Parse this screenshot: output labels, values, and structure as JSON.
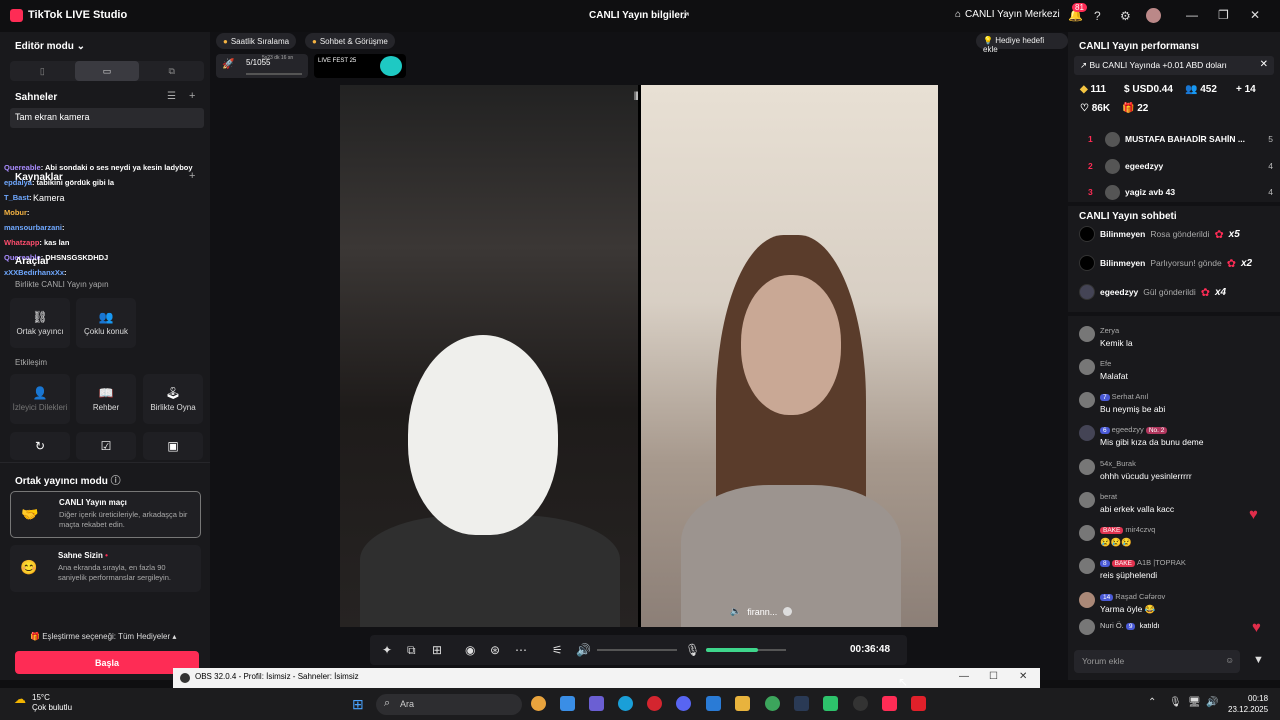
{
  "titlebar": {
    "app_title": "TikTok LIVE Studio",
    "center_title": "CANLI Yayın bilgileri",
    "center_link": "CANLI Yayın Merkezi",
    "notif_count": "81"
  },
  "left": {
    "editor_mode": "Editör modu",
    "scenes_label": "Sahneler",
    "scene_item": "Tam ekran kamera",
    "sources_label": "Kaynaklar",
    "camera_label": "Kamera",
    "tools_label": "Araçlar",
    "together_label": "Birlikte CANLI Yayın yapın",
    "tool_cohost": "Ortak yayıncı",
    "tool_multiguest": "Çoklu konuk",
    "interaction_label": "Etkileşim",
    "tool_viewer": "İzleyici Dilekleri",
    "tool_guide": "Rehber",
    "tool_playtogether": "Birlikte Oyna",
    "cohost_mode": "Ortak yayıncı modu",
    "card1_title": "CANLI Yayın maçı",
    "card1_desc": "Diğer içerik üreticileriyle, arkadaşça bir maçta rekabet edin.",
    "card2_title": "Sahne Sizin",
    "card2_desc": "Ana ekranda sırayla, en fazla 90 saniyelik performanslar sergileyin.",
    "match_option": "Eşleştirme seçeneği: Tüm Hediyeler",
    "start_button": "Başla"
  },
  "chat_overlay": [
    {
      "user": "Quereable",
      "text": ": Abi sondaki o ses neydi ya kesin ladyboy",
      "color": "#a98cff"
    },
    {
      "user": "epdalya",
      "text": ": tabikini gördük gibi la",
      "color": "#6fa8ff"
    },
    {
      "user": "T_Bast",
      "text": ":",
      "color": "#6fa8ff"
    },
    {
      "user": "Mobur",
      "text": ":",
      "color": "#f5b342"
    },
    {
      "user": "mansourbarzani",
      "text": ":",
      "color": "#6fa8ff"
    },
    {
      "user": "Whatzapp",
      "text": ": kas lan",
      "color": "#ff4d6d"
    },
    {
      "user": "Quereable",
      "text": ": DHSNSGSKDHDJ",
      "color": "#a98cff"
    },
    {
      "user": "xXXBedirhanxXx",
      "text": ":",
      "color": "#6fa8ff"
    }
  ],
  "center": {
    "pill1": "Saatlik Sıralama",
    "pill2": "Sohbet & Görüşme",
    "goal": "Hediye hedefi ekle",
    "progress": "5/1055",
    "progress_time": "5s23 dk 16 sn",
    "fest": "LIVE FEST 25",
    "guest_name": "firann...",
    "timer": "00:36:48",
    "mic_level": 0.65
  },
  "right": {
    "perf_title": "CANLI Yayın performansı",
    "promo": "Bu CANLI Yayında +0.01 ABD doları",
    "stats": {
      "diamonds": "111",
      "usd": "USD0.44",
      "viewers": "452",
      "new": "14",
      "likes": "86K",
      "gifts": "22"
    },
    "ranking": [
      {
        "rank": "1",
        "name": "MUSTAFA BAHADİR SAHİN ...",
        "score": "5"
      },
      {
        "rank": "2",
        "name": "egeedzyy",
        "score": "4"
      },
      {
        "rank": "3",
        "name": "yagiz avb 43",
        "score": "4"
      }
    ],
    "chat_title": "CANLI Yayın sohbeti",
    "gifts": [
      {
        "user": "Bilinmeyen",
        "text": "Rosa gönderildi",
        "count": "x5"
      },
      {
        "user": "Bilinmeyen",
        "text": "Parlıyorsun! gönde",
        "count": "x2"
      },
      {
        "user": "egeedzyy",
        "text": "Gül gönderildi",
        "count": "x4"
      }
    ],
    "comments": [
      {
        "user": "Zerya",
        "text": "Kemik la",
        "badge": ""
      },
      {
        "user": "Efe",
        "text": "Malafat",
        "badge": ""
      },
      {
        "user": "Serhat Anıl",
        "text": "Bu neymiş be abi",
        "badge": "7"
      },
      {
        "user": "egeedzyy",
        "text": "Mis gibi kıza da bunu deme",
        "badge": "6",
        "badge2": "No. 2"
      },
      {
        "user": "54x_Burak",
        "text": "ohhh vücudu yesinlerrrrr",
        "badge": ""
      },
      {
        "user": "berat",
        "text": "abi erkek valla kacc",
        "badge": ""
      },
      {
        "user": "mir4czvq",
        "text": "😢😢😢",
        "badge": "BAKE"
      },
      {
        "user": "A1B |TOPRAK",
        "text": "reis şüphelendi",
        "badge": "8",
        "badge2": "BAKE"
      },
      {
        "user": "Raşad Cəfərov",
        "text": "Yarma öyle 😂",
        "badge": "14"
      },
      {
        "user": "Nuri Ö.",
        "text": "katıldı",
        "badge": "9"
      }
    ],
    "comment_placeholder": "Yorum ekle"
  },
  "obs": {
    "title": "OBS 32.0.4 - Profil: İsimsiz - Sahneler: İsimsiz"
  },
  "taskbar": {
    "temp": "15°C",
    "weather": "Çok bulutlu",
    "search": "Ara",
    "time": "00:18",
    "date": "23.12.2025"
  },
  "colors": {
    "accent": "#fe2c55",
    "panel": "#19191c",
    "mic": "#3fd68c"
  }
}
